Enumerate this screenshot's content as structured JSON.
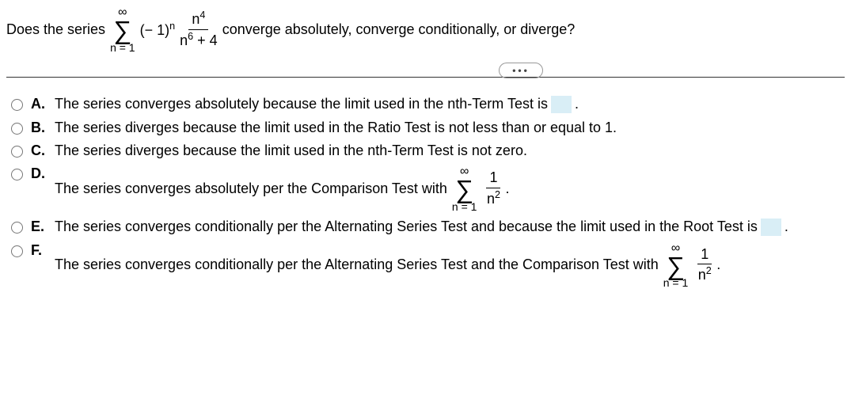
{
  "question": {
    "prefix": "Does the series",
    "sigma": {
      "top": "∞",
      "symbol": "∑",
      "bottom": "n = 1"
    },
    "term_base": "(− 1)",
    "term_exp": "n",
    "frac_num_base": "n",
    "frac_num_exp": "4",
    "frac_den_base": "n",
    "frac_den_exp": "6",
    "frac_den_tail": " + 4",
    "suffix": "converge absolutely, converge conditionally, or diverge?"
  },
  "ellipsis": "•••",
  "options": {
    "A": {
      "letter": "A.",
      "text_before": "The series converges absolutely because the limit used in the nth-Term Test is ",
      "has_blank": true,
      "text_after": "."
    },
    "B": {
      "letter": "B.",
      "text": "The series diverges because the limit used in the Ratio Test is not less than or equal to 1."
    },
    "C": {
      "letter": "C.",
      "text": "The series diverges because the limit used in the nth-Term Test is not zero."
    },
    "D": {
      "letter": "D.",
      "text_before": "The series converges absolutely per the Comparison Test with ",
      "sigma": {
        "top": "∞",
        "symbol": "∑",
        "bottom": "n = 1"
      },
      "frac_num": "1",
      "frac_den_base": "n",
      "frac_den_exp": "2",
      "text_after": "."
    },
    "E": {
      "letter": "E.",
      "text_before": "The series converges conditionally per the Alternating Series Test and because the limit used in the Root Test is ",
      "has_blank": true,
      "text_after": "."
    },
    "F": {
      "letter": "F.",
      "text_before": "The series converges conditionally per the Alternating Series Test and the Comparison Test with ",
      "sigma": {
        "top": "∞",
        "symbol": "∑",
        "bottom": "n = 1"
      },
      "frac_num": "1",
      "frac_den_base": "n",
      "frac_den_exp": "2",
      "text_after": "."
    }
  }
}
